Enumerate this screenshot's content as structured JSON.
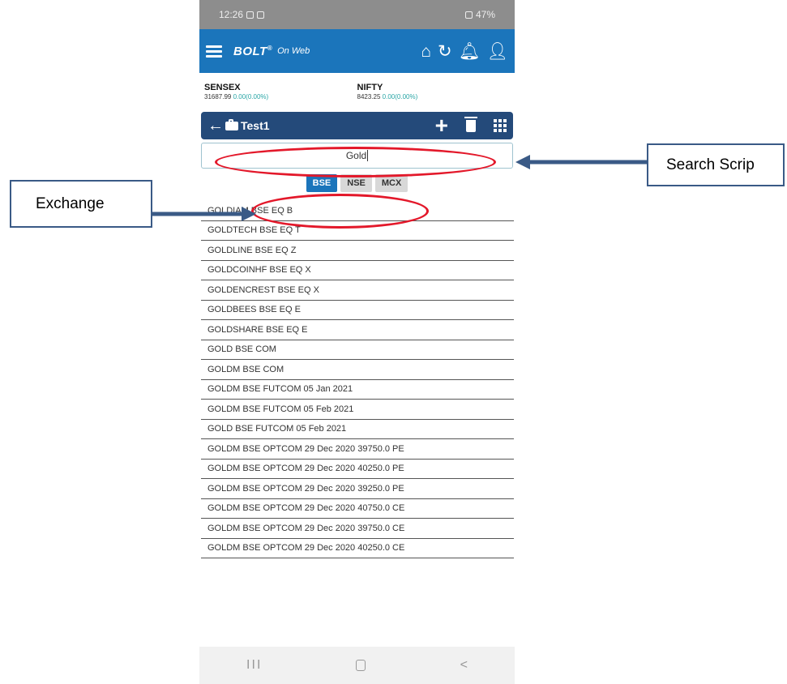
{
  "status_bar": {
    "time": "12:26",
    "battery": "47%"
  },
  "app_bar": {
    "logo": "BOLT",
    "logo_suffix": "On Web"
  },
  "indices": [
    {
      "name": "SENSEX",
      "value": "31687.99",
      "change": "0.00(0.00%)"
    },
    {
      "name": "NIFTY",
      "value": "8423.25",
      "change": "0.00(0.00%)"
    }
  ],
  "watchlist": {
    "name": "Test1"
  },
  "search": {
    "value": "Gold"
  },
  "exchanges": [
    {
      "label": "BSE",
      "active": true
    },
    {
      "label": "NSE",
      "active": false
    },
    {
      "label": "MCX",
      "active": false
    }
  ],
  "results": [
    "GOLDIAM  BSE EQ B",
    "GOLDTECH  BSE EQ T",
    "GOLDLINE  BSE EQ Z",
    "GOLDCOINHF  BSE EQ X",
    "GOLDENCREST  BSE EQ X",
    "GOLDBEES  BSE EQ E",
    "GOLDSHARE  BSE EQ E",
    "GOLD  BSE COM",
    "GOLDM  BSE COM",
    "GOLDM  BSE FUTCOM 05 Jan 2021",
    "GOLDM  BSE FUTCOM 05 Feb 2021",
    "GOLD  BSE FUTCOM 05 Feb 2021",
    "GOLDM  BSE OPTCOM 29 Dec 2020 39750.0 PE",
    "GOLDM  BSE OPTCOM 29 Dec 2020 40250.0 PE",
    "GOLDM  BSE OPTCOM 29 Dec 2020 39250.0 PE",
    "GOLDM  BSE OPTCOM 29 Dec 2020 40750.0 CE",
    "GOLDM  BSE OPTCOM 29 Dec 2020 39750.0 CE",
    "GOLDM  BSE OPTCOM 29 Dec 2020 40250.0 CE"
  ],
  "nav": {
    "recent": "III",
    "back": "<"
  },
  "annotations": {
    "search_label": "Search Scrip",
    "exchange_label": "Exchange",
    "highlight_color": "#e3182a",
    "arrow_color": "#3a5a86"
  },
  "colors": {
    "app_bar": "#1b75bb",
    "watchlist_header": "#244a7a",
    "active_exchange": "#1b75bb"
  }
}
